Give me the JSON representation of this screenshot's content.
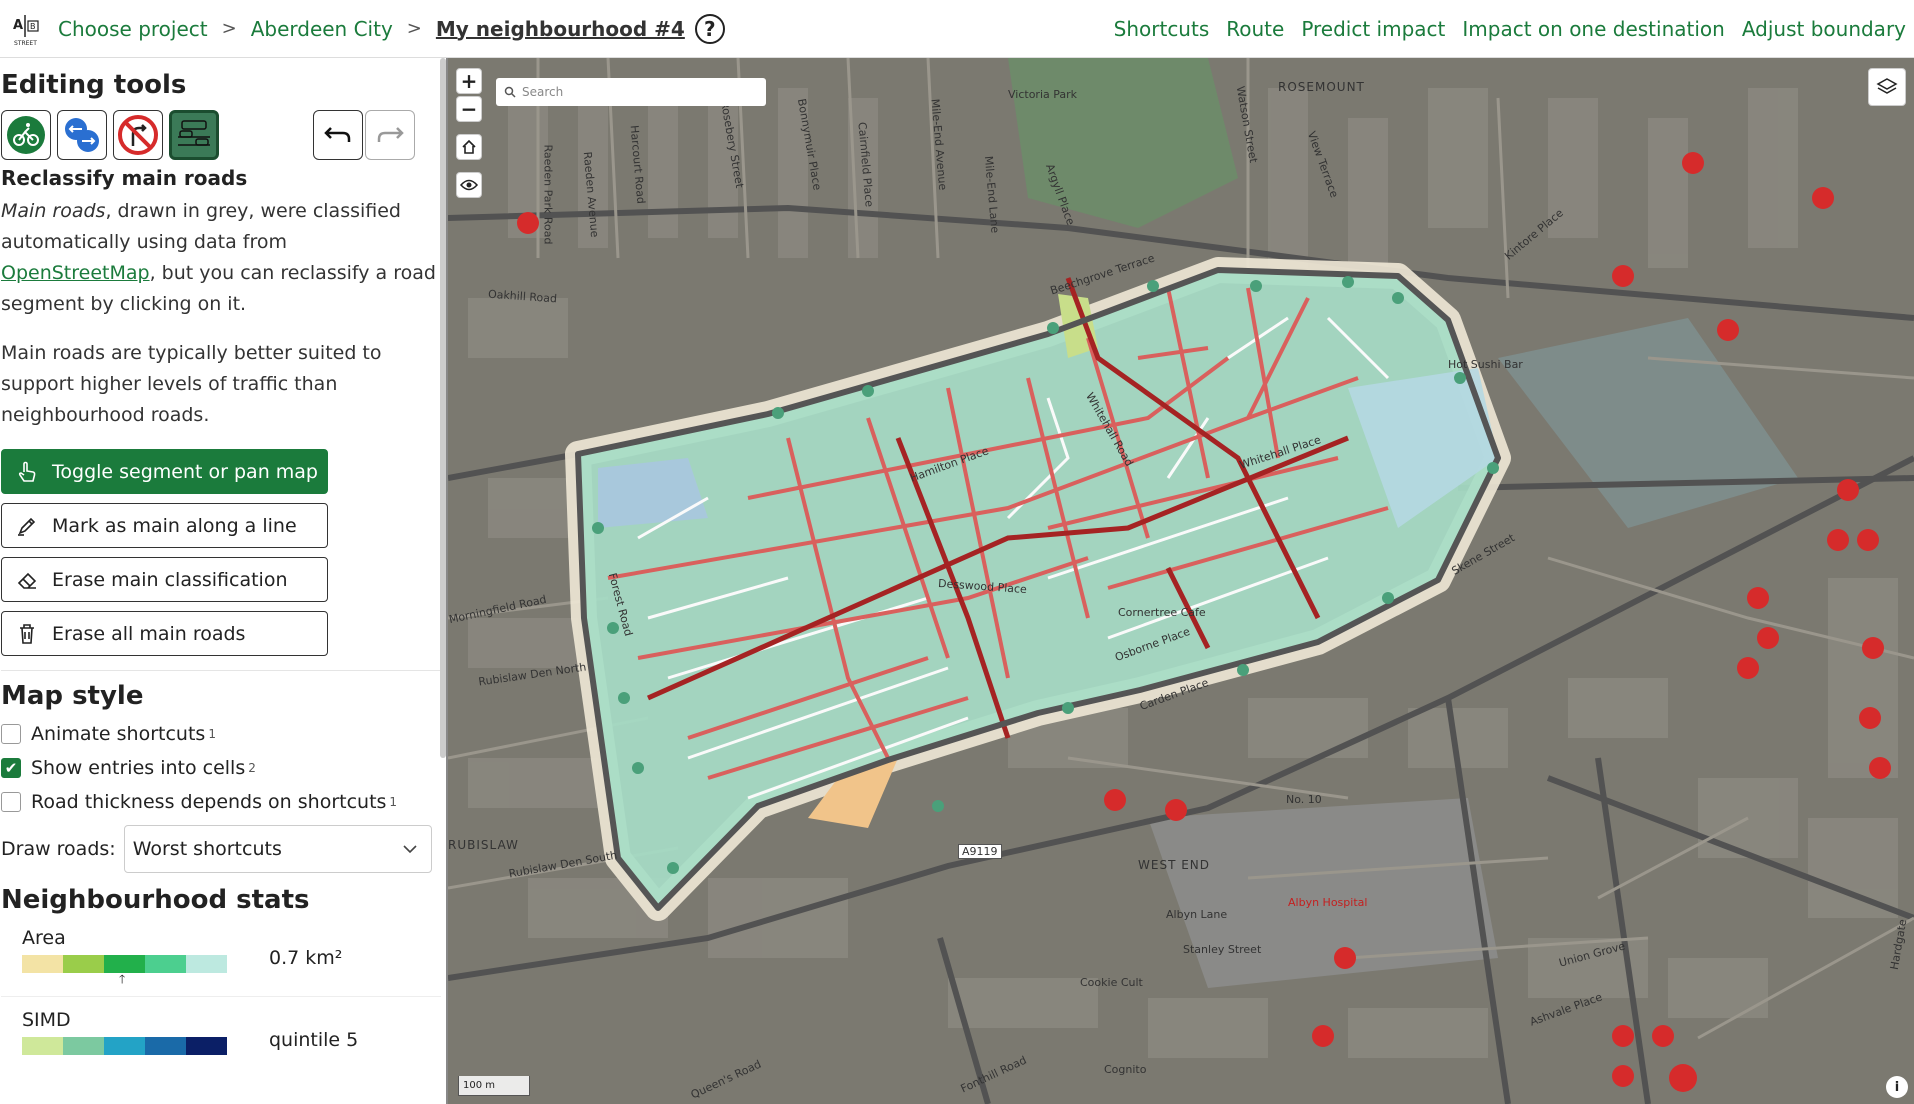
{
  "header": {
    "breadcrumbs": [
      "Choose project",
      "Aberdeen City"
    ],
    "current": "My neighbourhood #4",
    "help_glyph": "?",
    "nav": [
      "Shortcuts",
      "Route",
      "Predict impact",
      "Impact on one destination",
      "Adjust boundary"
    ]
  },
  "editing": {
    "title": "Editing tools",
    "tool_title": "Reclassify main roads",
    "para1_em": "Main roads",
    "para1_a": ", drawn in grey, were classified automatically using data from ",
    "para1_link": "OpenStreetMap",
    "para1_b": ", but you can reclassify a road segment by clicking on it.",
    "para2": "Main roads are typically better suited to support higher levels of traffic than neighbourhood roads.",
    "buttons": [
      "Toggle segment or pan map",
      "Mark as main along a line",
      "Erase main classification",
      "Erase all main roads"
    ]
  },
  "map_style": {
    "title": "Map style",
    "options": [
      {
        "label": "Animate shortcuts",
        "sup": "1",
        "checked": false
      },
      {
        "label": "Show entries into cells",
        "sup": "2",
        "checked": true
      },
      {
        "label": "Road thickness depends on shortcuts",
        "sup": "1",
        "checked": false
      }
    ],
    "draw_roads_label": "Draw roads:",
    "draw_roads_value": "Worst shortcuts"
  },
  "stats": {
    "title": "Neighbourhood stats",
    "area_label": "Area",
    "area_value": "0.7 km²",
    "simd_label": "SIMD",
    "simd_value": "quintile 5",
    "area_colors": [
      "#f3e3a5",
      "#9acd4a",
      "#22b04b",
      "#4ccf8f",
      "#bde9e0"
    ],
    "simd_colors": [
      "#cfe89a",
      "#7cc9a0",
      "#23a3c6",
      "#1a6aa8",
      "#0b1f66"
    ]
  },
  "map": {
    "search_placeholder": "Search",
    "scale": "100 m",
    "labels": [
      "ROSEMOUNT",
      "Victoria Park",
      "Raeden Park Road",
      "Raeden Avenue",
      "Harcourt Road",
      "Rosebery Street",
      "Bonnymuir Place",
      "Cairnfield Place",
      "Mile-End Avenue",
      "Mile-End Lane",
      "Argyll Place",
      "Watson Street",
      "View Terrace",
      "Kintore Place",
      "Beechgrove Terrace",
      "Oakhill Road",
      "Hamilton Place",
      "Whitehall Road",
      "Whitehall Place",
      "Hot Sushi Bar",
      "Forest Road",
      "Morningfield Road",
      "Rubislaw Den North",
      "Rubislaw Den South",
      "Desswood Place",
      "Cornertree Cafe",
      "Osborne Place",
      "Skene Street",
      "Carden Place",
      "No. 10",
      "A9119",
      "RUBISLAW",
      "WEST END",
      "Albyn Hospital",
      "Albyn Lane",
      "Stanley Street",
      "Cookie Cult",
      "Union Grove",
      "Ashvale Place",
      "Cognito",
      "Hardgate",
      "Queen's Road",
      "Fonthill Road"
    ]
  }
}
